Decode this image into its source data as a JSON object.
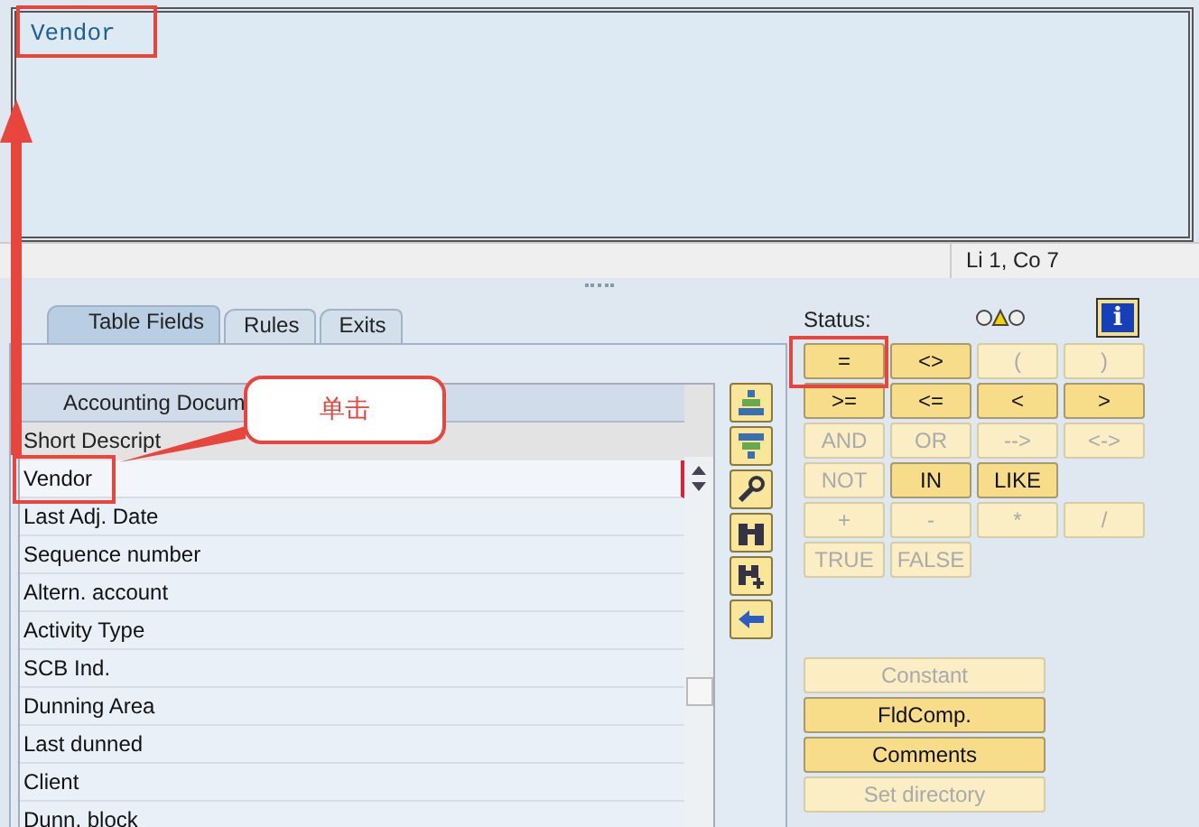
{
  "editor": {
    "text": "Vendor"
  },
  "status_bar": {
    "position": "Li 1, Co 7"
  },
  "tabs": [
    {
      "label": "Table Fields",
      "selected": true
    },
    {
      "label": "Rules",
      "selected": false
    },
    {
      "label": "Exits",
      "selected": false
    }
  ],
  "field_list": {
    "header": "Accounting Docum",
    "subheader": "Short Descript",
    "rows": [
      {
        "label": "Vendor",
        "selected": true
      },
      {
        "label": "Last Adj. Date",
        "selected": false
      },
      {
        "label": "Sequence number",
        "selected": false
      },
      {
        "label": "Altern. account",
        "selected": false
      },
      {
        "label": "Activity Type",
        "selected": false
      },
      {
        "label": "SCB Ind.",
        "selected": false
      },
      {
        "label": "Dunning Area",
        "selected": false
      },
      {
        "label": "Last dunned",
        "selected": false
      },
      {
        "label": "Client",
        "selected": false
      },
      {
        "label": "Dunn. block",
        "selected": false
      }
    ]
  },
  "status_label": "Status:",
  "info_button": "i",
  "operator_rows": [
    [
      {
        "label": "=",
        "disabled": false
      },
      {
        "label": "<>",
        "disabled": false
      },
      {
        "label": "(",
        "disabled": true
      },
      {
        "label": ")",
        "disabled": true
      }
    ],
    [
      {
        "label": ">=",
        "disabled": false
      },
      {
        "label": "<=",
        "disabled": false
      },
      {
        "label": "<",
        "disabled": false
      },
      {
        "label": ">",
        "disabled": false
      }
    ],
    [
      {
        "label": "AND",
        "disabled": true
      },
      {
        "label": "OR",
        "disabled": true
      },
      {
        "label": "-->",
        "disabled": true
      },
      {
        "label": "<->",
        "disabled": true
      }
    ],
    [
      {
        "label": "NOT",
        "disabled": true
      },
      {
        "label": "IN",
        "disabled": false
      },
      {
        "label": "LIKE",
        "disabled": false
      }
    ],
    [
      {
        "label": "+",
        "disabled": true
      },
      {
        "label": "-",
        "disabled": true
      },
      {
        "label": "*",
        "disabled": true
      },
      {
        "label": "/",
        "disabled": true
      }
    ],
    [
      {
        "label": "TRUE",
        "disabled": true
      },
      {
        "label": "FALSE",
        "disabled": true
      }
    ]
  ],
  "action_buttons": [
    {
      "label": "Constant",
      "disabled": true
    },
    {
      "label": "FldComp.",
      "disabled": false
    },
    {
      "label": "Comments",
      "disabled": false
    },
    {
      "label": "Set directory",
      "disabled": true
    }
  ],
  "callout": {
    "text": "单击"
  }
}
